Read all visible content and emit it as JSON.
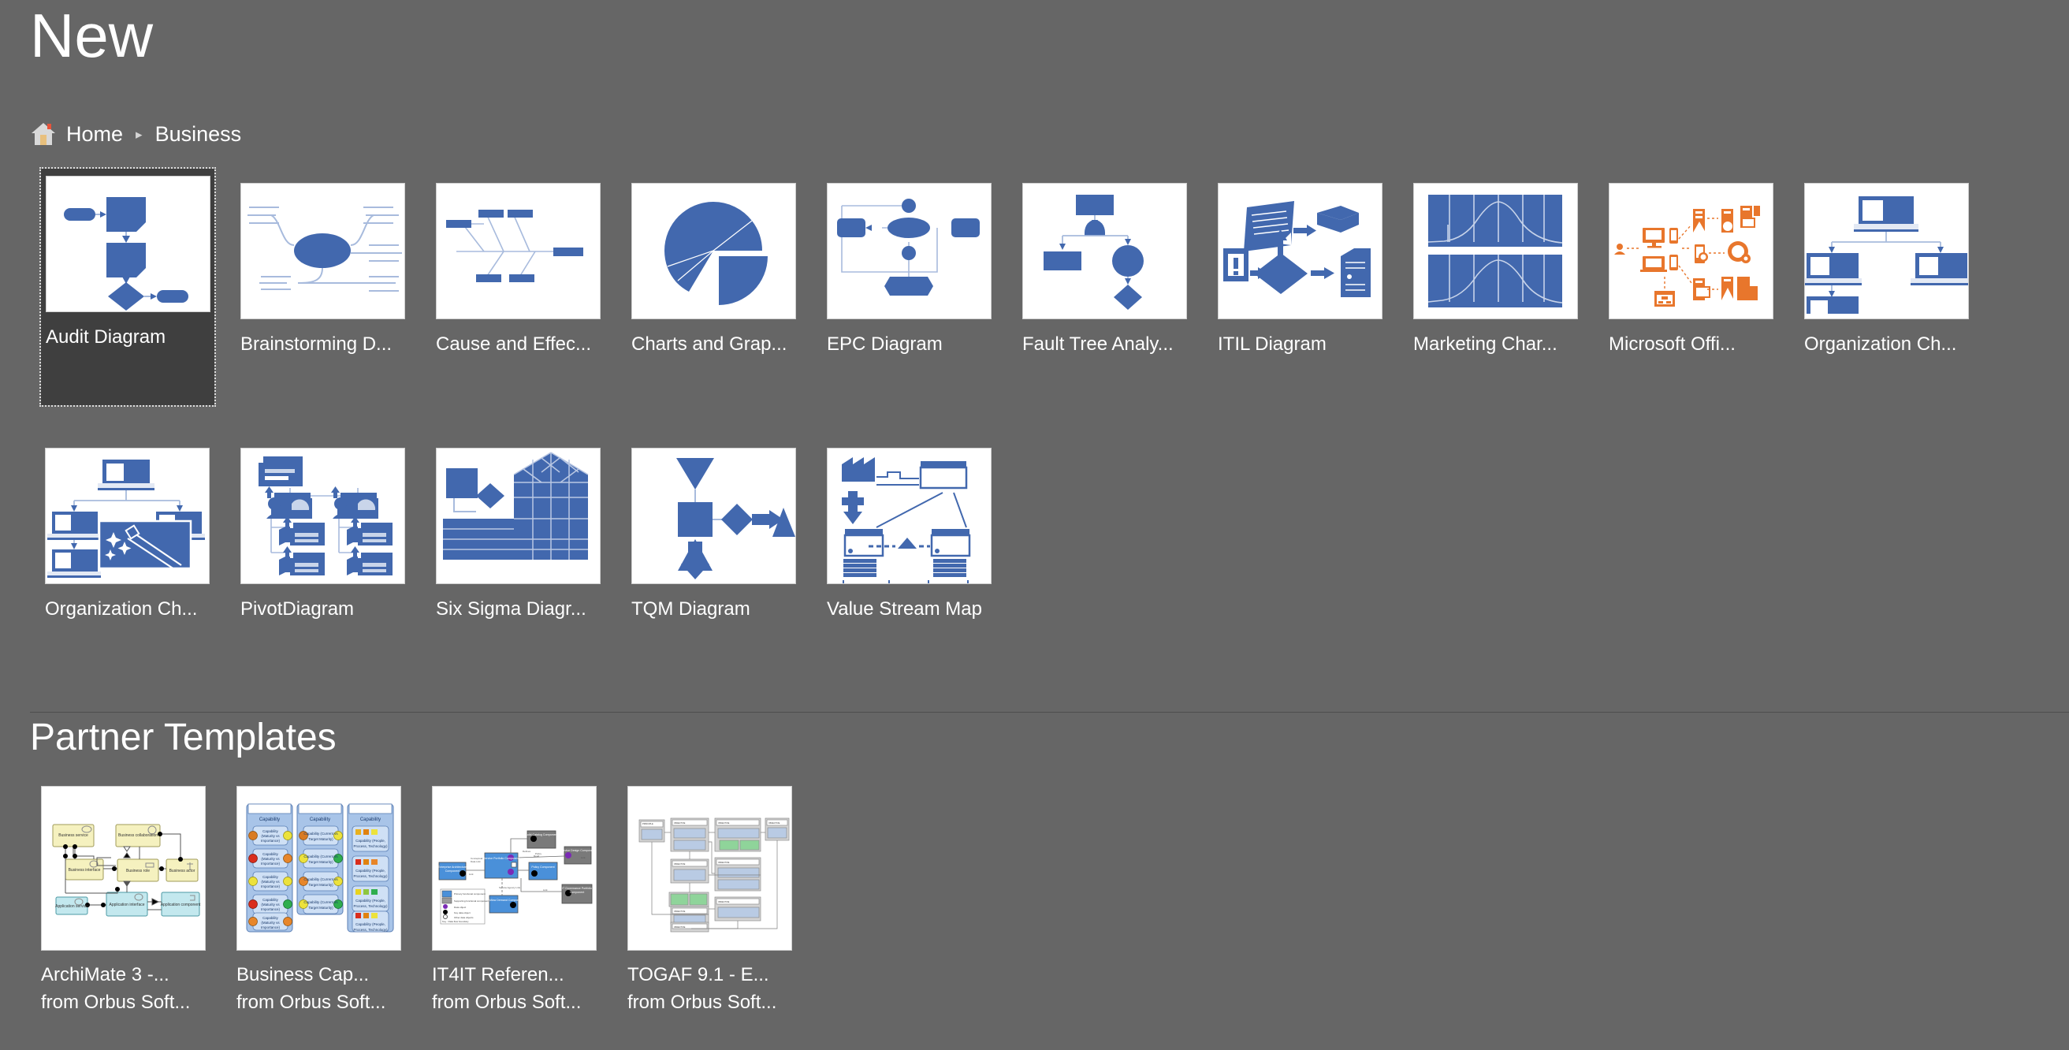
{
  "header": {
    "title": "New",
    "breadcrumb": {
      "home_icon": "home-icon",
      "home_label": "Home",
      "separator": "▸",
      "current_label": "Business"
    }
  },
  "templates": {
    "row1": [
      {
        "label": "Audit Diagram",
        "thumb": "audit-diagram-thumb",
        "selected": true
      },
      {
        "label": "Brainstorming D...",
        "thumb": "brainstorming-thumb",
        "selected": false
      },
      {
        "label": "Cause and Effec...",
        "thumb": "cause-and-effect-thumb",
        "selected": false
      },
      {
        "label": "Charts and Grap...",
        "thumb": "charts-and-graphs-thumb",
        "selected": false
      },
      {
        "label": "EPC Diagram",
        "thumb": "epc-diagram-thumb",
        "selected": false
      },
      {
        "label": "Fault Tree Analy...",
        "thumb": "fault-tree-thumb",
        "selected": false
      },
      {
        "label": "ITIL Diagram",
        "thumb": "itil-diagram-thumb",
        "selected": false
      },
      {
        "label": "Marketing Char...",
        "thumb": "marketing-charts-thumb",
        "selected": false
      },
      {
        "label": "Microsoft Offi...",
        "thumb": "microsoft-office-thumb",
        "selected": false
      },
      {
        "label": "Organization Ch...",
        "thumb": "org-chart-thumb",
        "selected": false
      }
    ],
    "row2": [
      {
        "label": "Organization Ch...",
        "thumb": "org-chart-wizard-thumb",
        "selected": false
      },
      {
        "label": "PivotDiagram",
        "thumb": "pivot-diagram-thumb",
        "selected": false
      },
      {
        "label": "Six Sigma Diagr...",
        "thumb": "six-sigma-thumb",
        "selected": false
      },
      {
        "label": "TQM Diagram",
        "thumb": "tqm-diagram-thumb",
        "selected": false
      },
      {
        "label": "Value Stream Map",
        "thumb": "value-stream-map-thumb",
        "selected": false
      }
    ]
  },
  "partner": {
    "section_title": "Partner Templates",
    "items": [
      {
        "title": "ArchiMate 3 -...",
        "vendor": "from Orbus Soft...",
        "thumb": "archimate-thumb"
      },
      {
        "title": "Business Cap...",
        "vendor": "from Orbus Soft...",
        "thumb": "business-capability-thumb"
      },
      {
        "title": "IT4IT Referen...",
        "vendor": "from Orbus Soft...",
        "thumb": "it4it-thumb"
      },
      {
        "title": "TOGAF 9.1 - E...",
        "vendor": "from Orbus Soft...",
        "thumb": "togaf-thumb"
      }
    ]
  },
  "colors": {
    "background": "#666666",
    "selected_tile": "#3f3f3f",
    "thumb_blue": "#4268ae",
    "thumb_line": "#a8bbdd",
    "accent_orange": "#e8762c",
    "text": "#ffffff",
    "divider": "#4d4d4d"
  }
}
